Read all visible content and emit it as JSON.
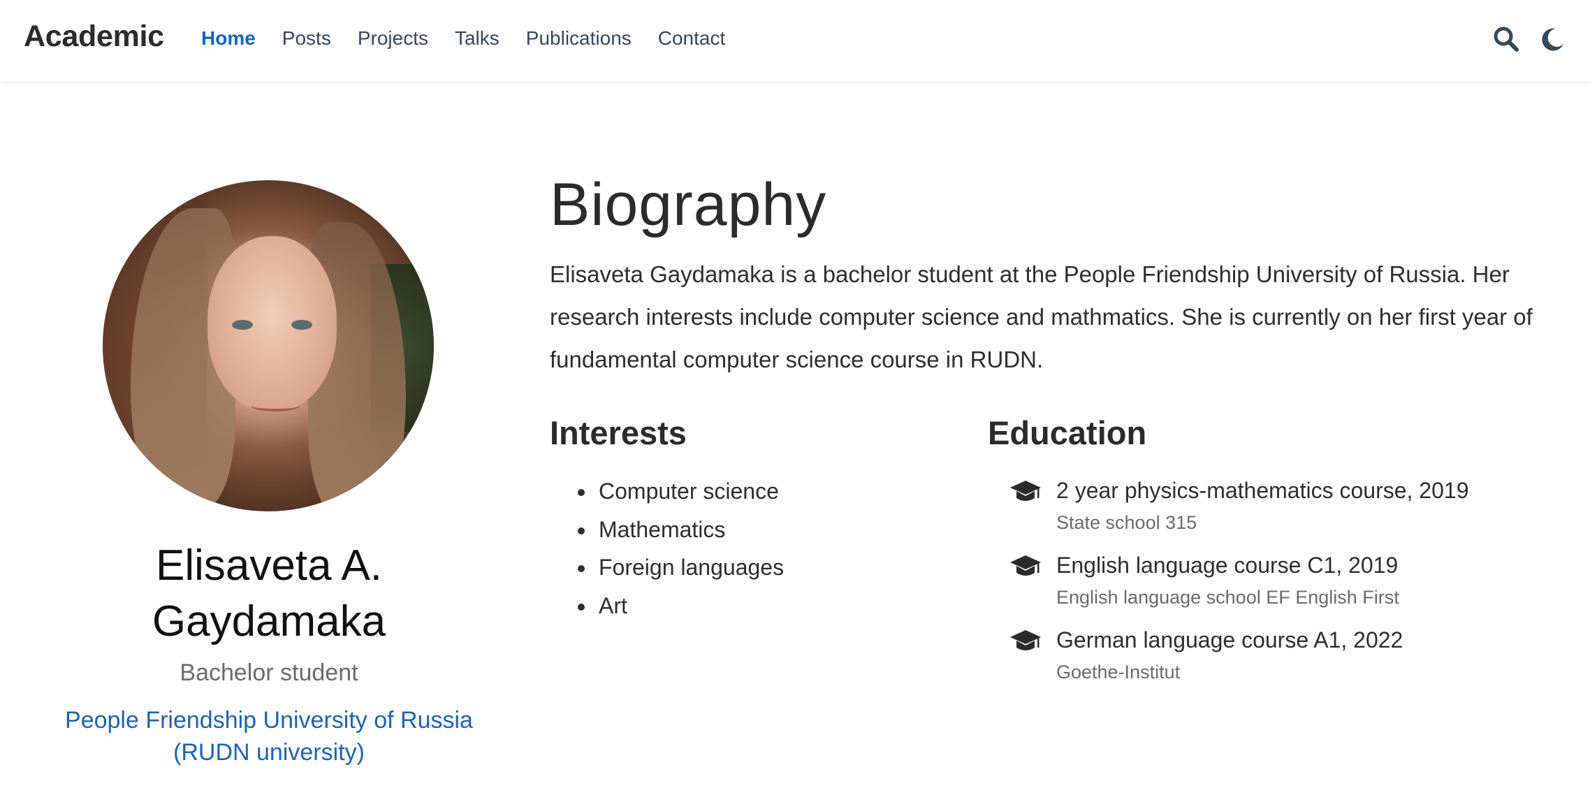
{
  "navbar": {
    "brand": "Academic",
    "links": [
      "Home",
      "Posts",
      "Projects",
      "Talks",
      "Publications",
      "Contact"
    ],
    "active": "Home",
    "icons": [
      "search-icon",
      "moon-icon"
    ]
  },
  "profile": {
    "name": "Elisaveta A. Gaydamaka",
    "role": "Bachelor student",
    "organization": "People Friendship University of Russia (RUDN university)"
  },
  "biography": {
    "title": "Biography",
    "text": "Elisaveta Gaydamaka is a bachelor student at the People Friendship University of Russia. Her research interests include computer science and mathmatics. She is currently on her first year of fundamental computer science course in RUDN."
  },
  "interests": {
    "title": "Interests",
    "items": [
      "Computer science",
      "Mathematics",
      "Foreign languages",
      "Art"
    ]
  },
  "education": {
    "title": "Education",
    "items": [
      {
        "course": "2 year physics-mathematics course, 2019",
        "institution": "State school 315"
      },
      {
        "course": "English language course C1, 2019",
        "institution": "English language school EF English First"
      },
      {
        "course": "German language course A1, 2022",
        "institution": "Goethe-Institut"
      }
    ]
  },
  "colors": {
    "accent": "#1565c0",
    "link": "#1e63b5",
    "text": "#2b2b2b",
    "muted": "#6b6b6b"
  }
}
